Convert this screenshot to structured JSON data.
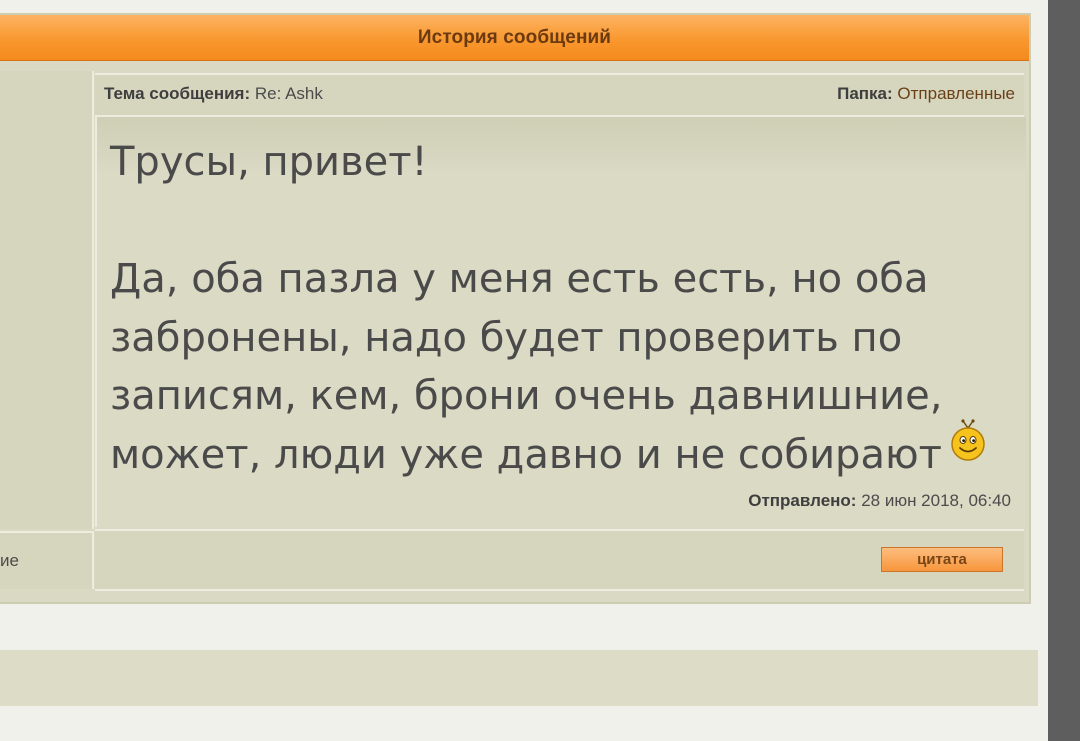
{
  "panel": {
    "title": "История сообщений"
  },
  "subject": {
    "label": "Тема сообщения:",
    "value": " Re: Ashk"
  },
  "folder": {
    "label": "Папка:",
    "value": " Отправленные"
  },
  "message": {
    "text": "Трусы, привет!\n\nДа, оба пазла у меня есть есть, но оба забронены, надо будет проверить по записям, кем, брони очень давнишние, может, люди уже давно и не собирают",
    "emoticon": "smiley-icon"
  },
  "sent": {
    "label": "Отправлено:",
    "value": " 28 июн 2018, 06:40"
  },
  "left_column": {
    "bottom_text": "ие"
  },
  "buttons": {
    "quote": "цитата"
  },
  "colors": {
    "header_orange": "#f9982f",
    "panel_bg": "#d9d9c4",
    "button_orange": "#f7963c"
  }
}
